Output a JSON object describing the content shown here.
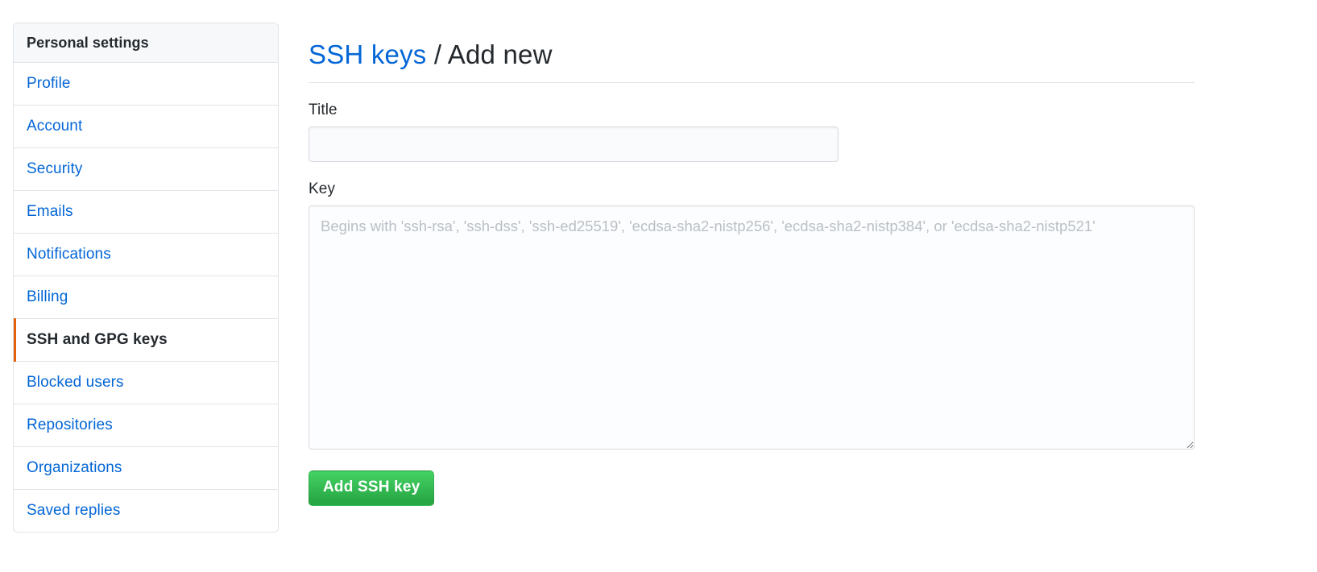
{
  "sidebar": {
    "heading": "Personal settings",
    "items": [
      {
        "label": "Profile",
        "selected": false
      },
      {
        "label": "Account",
        "selected": false
      },
      {
        "label": "Security",
        "selected": false
      },
      {
        "label": "Emails",
        "selected": false
      },
      {
        "label": "Notifications",
        "selected": false
      },
      {
        "label": "Billing",
        "selected": false
      },
      {
        "label": "SSH and GPG keys",
        "selected": true
      },
      {
        "label": "Blocked users",
        "selected": false
      },
      {
        "label": "Repositories",
        "selected": false
      },
      {
        "label": "Organizations",
        "selected": false
      },
      {
        "label": "Saved replies",
        "selected": false
      }
    ]
  },
  "header": {
    "link_text": "SSH keys",
    "separator": " / ",
    "current": "Add new"
  },
  "form": {
    "title_label": "Title",
    "title_value": "",
    "title_placeholder": "",
    "key_label": "Key",
    "key_value": "",
    "key_placeholder": "Begins with 'ssh-rsa', 'ssh-dss', 'ssh-ed25519', 'ecdsa-sha2-nistp256', 'ecdsa-sha2-nistp384', or 'ecdsa-sha2-nistp521'",
    "submit_label": "Add SSH key"
  },
  "colors": {
    "link_blue": "#0366d6",
    "active_marker_orange": "#e36209",
    "button_green": "#2cbe4e",
    "border_gray": "#e1e4e8",
    "heading_bg": "#f6f8fa",
    "text_dark": "#24292e",
    "placeholder_gray": "#b9bfc6"
  }
}
